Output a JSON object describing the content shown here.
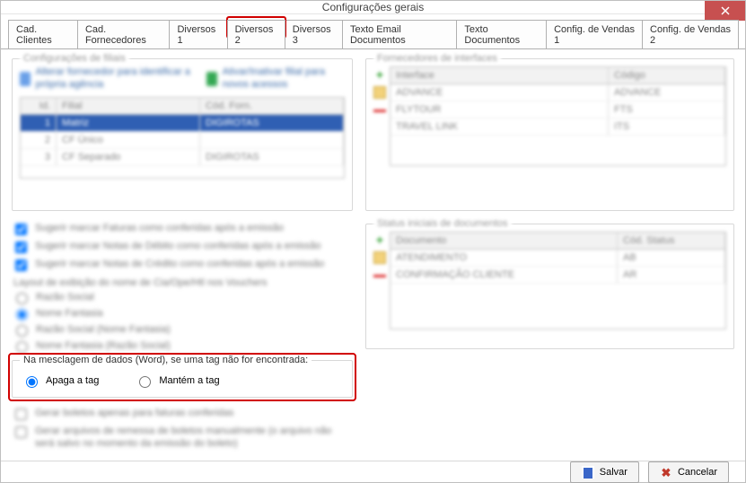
{
  "window": {
    "title": "Configurações gerais"
  },
  "tabs": [
    {
      "label": "Cad. Clientes"
    },
    {
      "label": "Cad. Fornecedores"
    },
    {
      "label": "Diversos 1"
    },
    {
      "label": "Diversos 2"
    },
    {
      "label": "Diversos 3"
    },
    {
      "label": "Texto Email Documentos"
    },
    {
      "label": "Texto Documentos"
    },
    {
      "label": "Config. de Vendas 1"
    },
    {
      "label": "Config. de Vendas 2"
    }
  ],
  "left": {
    "filiais": {
      "title": "Configurações de filiais",
      "tool1": "Alterar fornecedor para identificar a própria agência",
      "tool2": "Ativar/Inativar filial para novos acessos",
      "head": {
        "id": "Id.",
        "filial": "Filial",
        "cod": "Cód. Forn."
      },
      "rows": [
        {
          "id": "1",
          "filial": "Matriz",
          "cod": "DIGIROTAS"
        },
        {
          "id": "2",
          "filial": "CF Único",
          "cod": ""
        },
        {
          "id": "3",
          "filial": "CF Separado",
          "cod": "DIGIROTAS"
        }
      ]
    },
    "chk1": "Sugerir marcar Faturas como conferidas após a emissão",
    "chk2": "Sugerir marcar Notas de Débito como conferidas após a emissão",
    "chk3": "Sugerir marcar Notas de Crédito como conferidas após a emissão",
    "layoutLabel": "Layout de exibição do nome de Cia/Ope/Htl nos Vouchers",
    "r1": "Razão Social",
    "r2": "Nome Fantasia",
    "r3": "Razão Social (Nome Fantasia)",
    "r4": "Nome Fantasia (Razão Social)",
    "merge": {
      "title": "Na mesclagem de dados (Word), se uma tag não for encontrada:",
      "o1": "Apaga a tag",
      "o2": "Mantém a tag"
    },
    "chk4": "Gerar boletos apenas para faturas conferidas",
    "chk5": "Gerar arquivos de remessa de boletos manualmente (o arquivo não será salvo no momento da emissão do boleto)"
  },
  "right": {
    "fornInt": {
      "title": "Fornecedores de interfaces",
      "head": {
        "int": "Interface",
        "cod": "Código"
      },
      "rows": [
        {
          "int": "ADVANCE",
          "cod": "ADVANCE"
        },
        {
          "int": "FLYTOUR",
          "cod": "FTS"
        },
        {
          "int": "TRAVEL LINK",
          "cod": "ITS"
        }
      ]
    },
    "statusDoc": {
      "title": "Status iniciais de documentos",
      "head": {
        "doc": "Documento",
        "st": "Cód. Status"
      },
      "rows": [
        {
          "doc": "ATENDIMENTO",
          "st": "AB"
        },
        {
          "doc": "CONFIRMAÇÃO CLIENTE",
          "st": "AR"
        }
      ]
    }
  },
  "footer": {
    "save": "Salvar",
    "cancel": "Cancelar"
  }
}
